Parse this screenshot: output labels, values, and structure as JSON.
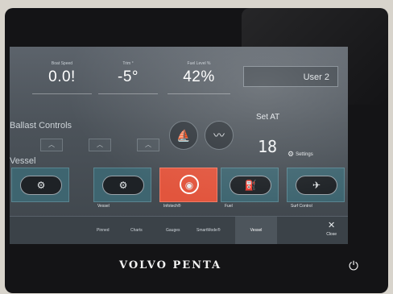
{
  "top_gauges": [
    {
      "label": "Boat Speed",
      "value": "0.0!"
    },
    {
      "label": "Trim °",
      "value": "-5°"
    },
    {
      "label": "Fuel Level %",
      "value": "42%"
    }
  ],
  "user_button": {
    "label": "User 2"
  },
  "ballast": {
    "title": "Ballast Controls"
  },
  "set_panel": {
    "title": "Set AT",
    "value": "18",
    "settings_label": "Settings"
  },
  "section_title": "Vessel",
  "tiles": [
    {
      "label": "",
      "icon": "vessel-engine-icon",
      "glyph": "⚙"
    },
    {
      "label": "Vessel",
      "icon": "engine-icon",
      "glyph": "⚙"
    },
    {
      "label": "Infotech®",
      "icon": "signal-icon",
      "glyph": "◉"
    },
    {
      "label": "Fuel",
      "icon": "fuel-icon",
      "glyph": "⛽"
    },
    {
      "label": "Surf Control",
      "icon": "surf-icon",
      "glyph": "✈"
    }
  ],
  "tabs": [
    "Pinned",
    "Charts",
    "Gauges",
    "SmartMode®",
    "Vessel"
  ],
  "close": {
    "label": "Close",
    "glyph": "✕"
  },
  "brand": "VOLVO PENTA",
  "power_glyph": "⏻"
}
